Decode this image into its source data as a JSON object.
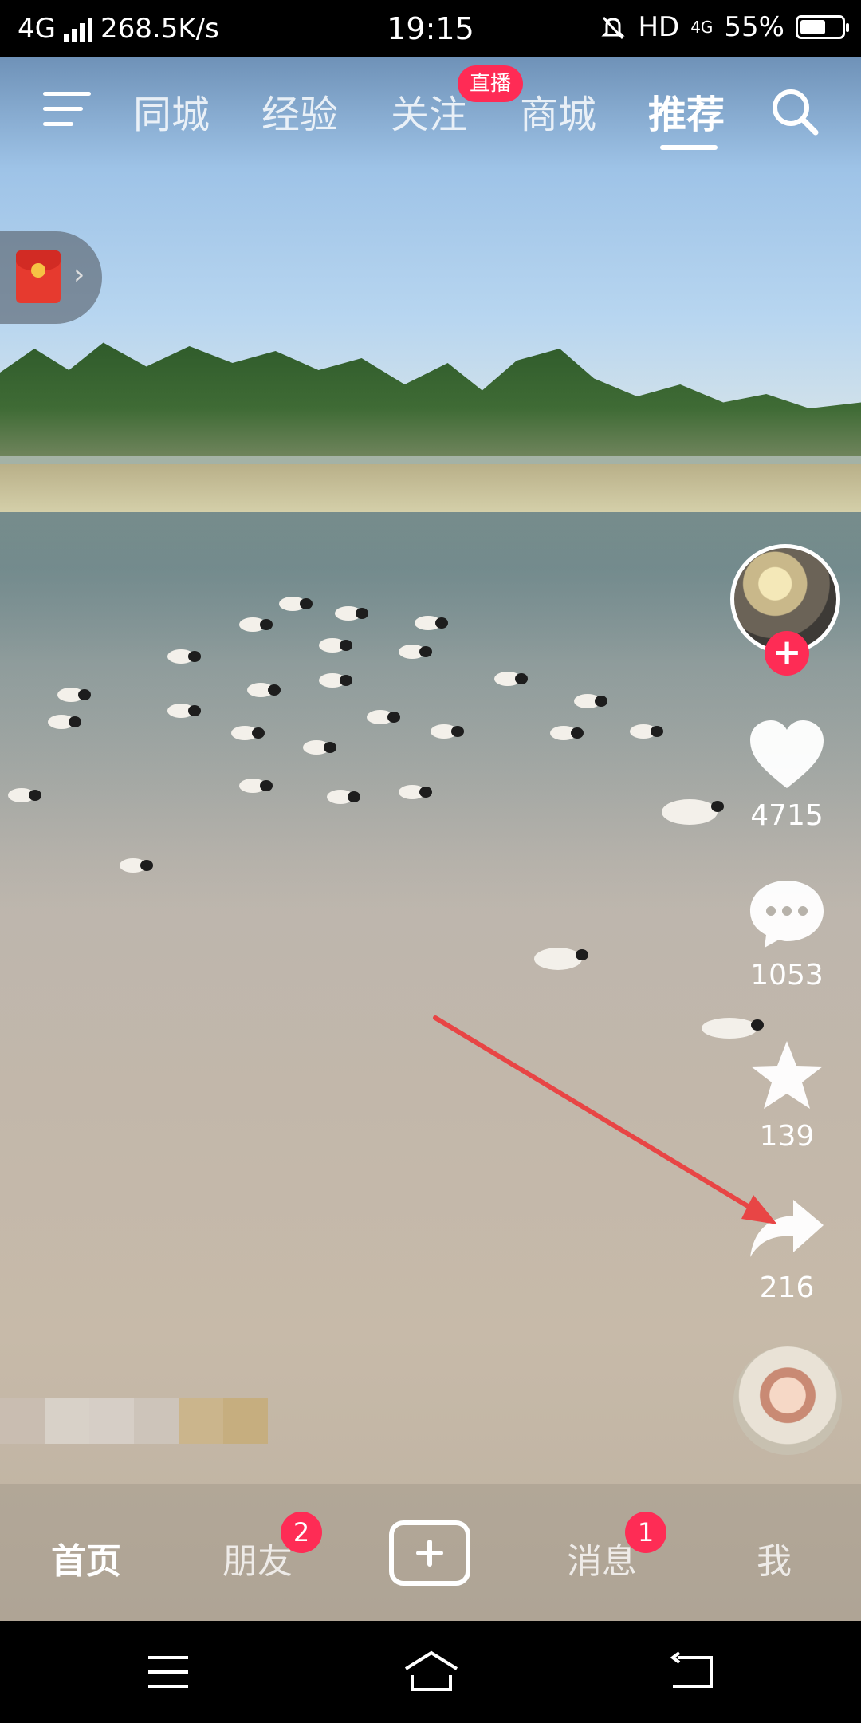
{
  "status_bar": {
    "network": "4G",
    "speed": "268.5K/s",
    "time": "19:15",
    "hd": "HD",
    "network_right": "4G",
    "battery": "55%"
  },
  "top_tabs": {
    "items": [
      "同城",
      "经验",
      "关注",
      "商城",
      "推荐"
    ],
    "active": "推荐",
    "live_badge": "直播"
  },
  "actions": {
    "likes": "4715",
    "comments": "1053",
    "favorites": "139",
    "shares": "216"
  },
  "bottom_nav": {
    "home": "首页",
    "friends": "朋友",
    "friends_badge": "2",
    "messages": "消息",
    "messages_badge": "1",
    "me": "我"
  },
  "colors": {
    "accent": "#fe2c55",
    "annotation_arrow": "#e84545"
  },
  "icons": [
    "menu-icon",
    "search-icon",
    "red-packet-icon",
    "heart-icon",
    "comment-icon",
    "star-icon",
    "share-icon",
    "plus-icon",
    "music-disc-icon"
  ]
}
